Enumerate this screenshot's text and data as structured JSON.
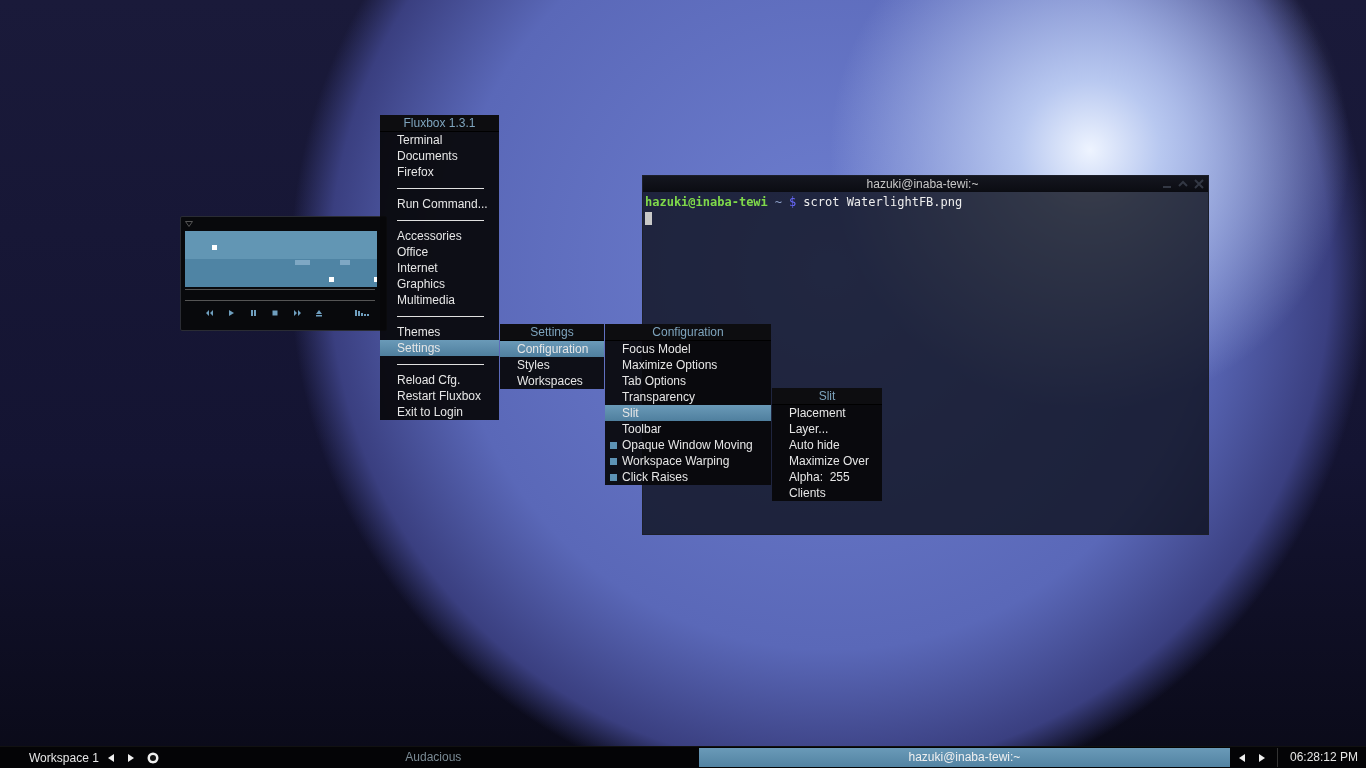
{
  "root_menu": {
    "title": "Fluxbox 1.3.1",
    "items": [
      {
        "kind": "item",
        "label": "Terminal",
        "selected": false
      },
      {
        "kind": "item",
        "label": "Documents",
        "selected": false
      },
      {
        "kind": "item",
        "label": "Firefox",
        "selected": false
      },
      {
        "kind": "separator"
      },
      {
        "kind": "item",
        "label": "Run Command...",
        "selected": false
      },
      {
        "kind": "separator"
      },
      {
        "kind": "item",
        "label": "Accessories",
        "selected": false
      },
      {
        "kind": "item",
        "label": "Office",
        "selected": false
      },
      {
        "kind": "item",
        "label": "Internet",
        "selected": false
      },
      {
        "kind": "item",
        "label": "Graphics",
        "selected": false
      },
      {
        "kind": "item",
        "label": "Multimedia",
        "selected": false
      },
      {
        "kind": "separator"
      },
      {
        "kind": "item",
        "label": "Themes",
        "selected": false
      },
      {
        "kind": "item",
        "label": "Settings",
        "selected": true
      },
      {
        "kind": "separator"
      },
      {
        "kind": "item",
        "label": "Reload Cfg.",
        "selected": false
      },
      {
        "kind": "item",
        "label": "Restart Fluxbox",
        "selected": false
      },
      {
        "kind": "item",
        "label": "Exit to Login",
        "selected": false
      }
    ]
  },
  "settings_menu": {
    "title": "Settings",
    "items": [
      {
        "kind": "item",
        "label": "Configuration",
        "selected": true
      },
      {
        "kind": "item",
        "label": "Styles",
        "selected": false
      },
      {
        "kind": "item",
        "label": "Workspaces",
        "selected": false
      }
    ]
  },
  "configuration_menu": {
    "title": "Configuration",
    "items": [
      {
        "kind": "item",
        "label": "Focus Model",
        "selected": false
      },
      {
        "kind": "item",
        "label": "Maximize Options",
        "selected": false
      },
      {
        "kind": "item",
        "label": "Tab Options",
        "selected": false
      },
      {
        "kind": "item",
        "label": "Transparency",
        "selected": false
      },
      {
        "kind": "item",
        "label": "Slit",
        "selected": true
      },
      {
        "kind": "item",
        "label": "Toolbar",
        "selected": false
      },
      {
        "kind": "toggle",
        "label": "Opaque Window Moving",
        "selected": false,
        "checked": true
      },
      {
        "kind": "toggle",
        "label": "Workspace Warping",
        "selected": false,
        "checked": true
      },
      {
        "kind": "toggle",
        "label": "Click Raises",
        "selected": false,
        "checked": true
      }
    ]
  },
  "slit_menu": {
    "title": "Slit",
    "items": [
      {
        "kind": "item",
        "label": "Placement",
        "selected": false
      },
      {
        "kind": "item",
        "label": "Layer...",
        "selected": false
      },
      {
        "kind": "item",
        "label": "Auto hide",
        "selected": false
      },
      {
        "kind": "item",
        "label": "Maximize Over",
        "selected": false
      },
      {
        "kind": "item",
        "label": "Alpha:  255",
        "selected": false
      },
      {
        "kind": "item",
        "label": "Clients",
        "selected": false
      }
    ]
  },
  "terminal": {
    "title": "hazuki@inaba-tewi:~",
    "prompt_user": "hazuki@inaba-tewi",
    "prompt_dir": "~",
    "prompt_symbol": "$",
    "command": "scrot WaterlightFB.png"
  },
  "toolbar": {
    "workspace": "Workspace 1",
    "tasks": [
      {
        "label": "Audacious",
        "selected": false
      },
      {
        "label": "hazuki@inaba-tewi:~",
        "selected": true
      }
    ],
    "clock": "06:28:12 PM"
  }
}
